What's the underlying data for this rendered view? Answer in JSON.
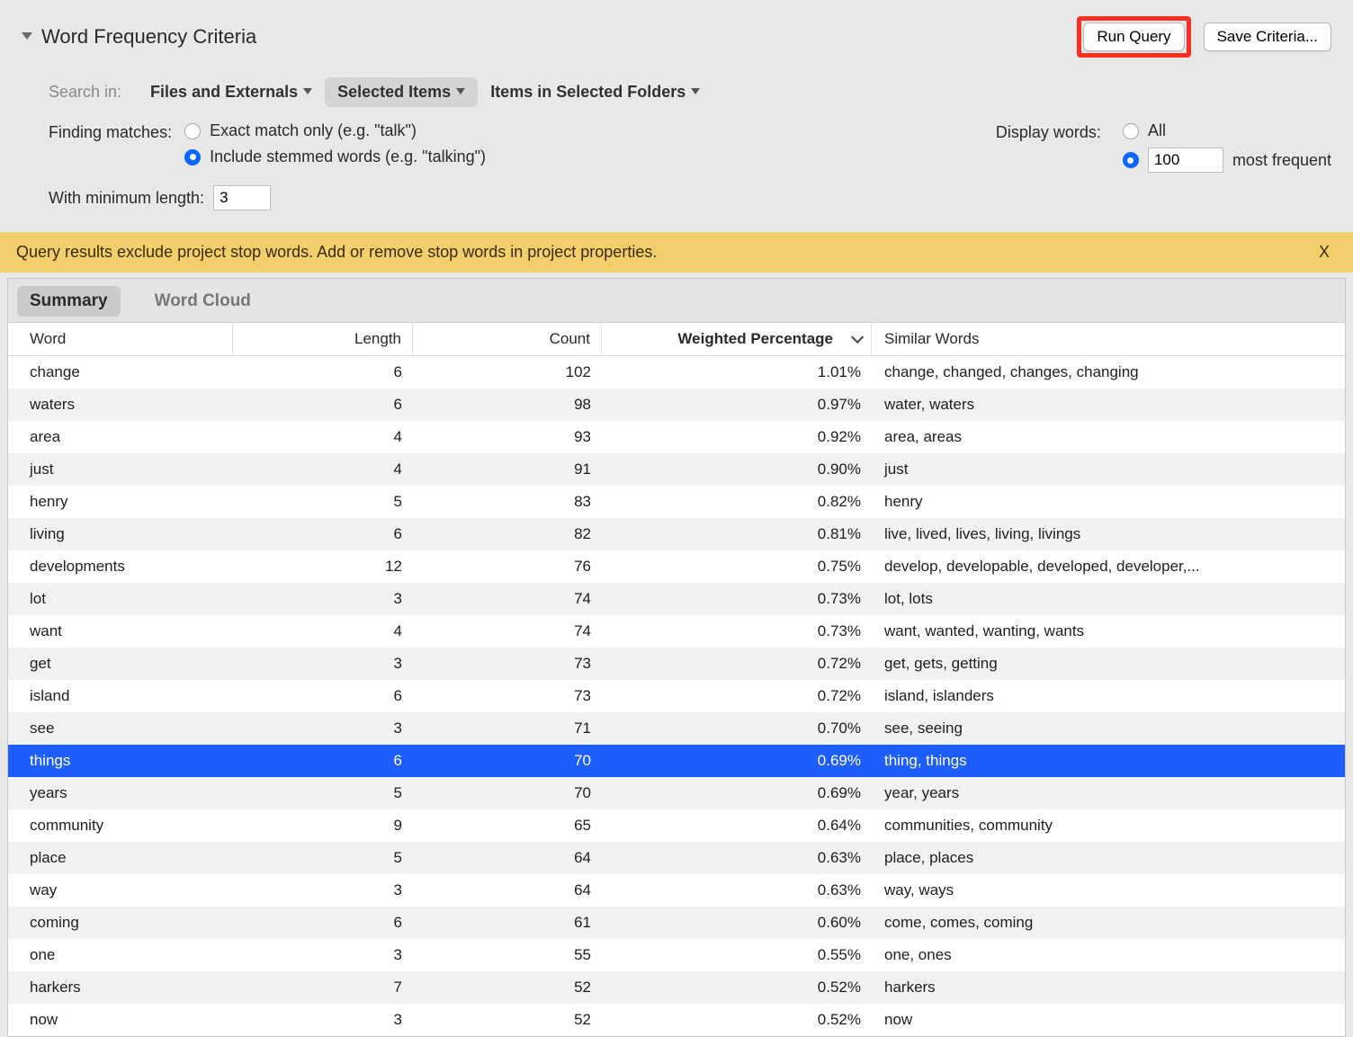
{
  "header": {
    "title": "Word Frequency Criteria",
    "run_query": "Run Query",
    "save_criteria": "Save Criteria..."
  },
  "search_in": {
    "label": "Search in:",
    "options": [
      "Files and Externals",
      "Selected Items",
      "Items in Selected Folders"
    ],
    "selected": "Selected Items"
  },
  "matches": {
    "label": "Finding matches:",
    "exact": "Exact match only (e.g. \"talk\")",
    "stemmed": "Include stemmed words (e.g. \"talking\")",
    "selected": "stemmed"
  },
  "display": {
    "label": "Display words:",
    "all": "All",
    "most_frequent_suffix": "most frequent",
    "count_value": "100",
    "selected": "count"
  },
  "min_length": {
    "label": "With minimum length:",
    "value": "3"
  },
  "notice": {
    "text": "Query results exclude project stop words. Add or remove stop words in project properties.",
    "close": "X"
  },
  "tabs": {
    "summary": "Summary",
    "wordcloud": "Word Cloud",
    "active": "summary"
  },
  "columns": {
    "word": "Word",
    "length": "Length",
    "count": "Count",
    "weighted": "Weighted Percentage",
    "similar": "Similar Words"
  },
  "selected_row": 12,
  "rows": [
    {
      "word": "change",
      "length": "6",
      "count": "102",
      "pct": "1.01%",
      "similar": "change, changed, changes, changing"
    },
    {
      "word": "waters",
      "length": "6",
      "count": "98",
      "pct": "0.97%",
      "similar": "water, waters"
    },
    {
      "word": "area",
      "length": "4",
      "count": "93",
      "pct": "0.92%",
      "similar": "area, areas"
    },
    {
      "word": "just",
      "length": "4",
      "count": "91",
      "pct": "0.90%",
      "similar": "just"
    },
    {
      "word": "henry",
      "length": "5",
      "count": "83",
      "pct": "0.82%",
      "similar": "henry"
    },
    {
      "word": "living",
      "length": "6",
      "count": "82",
      "pct": "0.81%",
      "similar": "live, lived, lives, living, livings"
    },
    {
      "word": "developments",
      "length": "12",
      "count": "76",
      "pct": "0.75%",
      "similar": "develop, developable, developed, developer,..."
    },
    {
      "word": "lot",
      "length": "3",
      "count": "74",
      "pct": "0.73%",
      "similar": "lot, lots"
    },
    {
      "word": "want",
      "length": "4",
      "count": "74",
      "pct": "0.73%",
      "similar": "want, wanted, wanting, wants"
    },
    {
      "word": "get",
      "length": "3",
      "count": "73",
      "pct": "0.72%",
      "similar": "get, gets, getting"
    },
    {
      "word": "island",
      "length": "6",
      "count": "73",
      "pct": "0.72%",
      "similar": "island, islanders"
    },
    {
      "word": "see",
      "length": "3",
      "count": "71",
      "pct": "0.70%",
      "similar": "see, seeing"
    },
    {
      "word": "things",
      "length": "6",
      "count": "70",
      "pct": "0.69%",
      "similar": "thing, things"
    },
    {
      "word": "years",
      "length": "5",
      "count": "70",
      "pct": "0.69%",
      "similar": "year, years"
    },
    {
      "word": "community",
      "length": "9",
      "count": "65",
      "pct": "0.64%",
      "similar": "communities, community"
    },
    {
      "word": "place",
      "length": "5",
      "count": "64",
      "pct": "0.63%",
      "similar": "place, places"
    },
    {
      "word": "way",
      "length": "3",
      "count": "64",
      "pct": "0.63%",
      "similar": "way, ways"
    },
    {
      "word": "coming",
      "length": "6",
      "count": "61",
      "pct": "0.60%",
      "similar": "come, comes, coming"
    },
    {
      "word": "one",
      "length": "3",
      "count": "55",
      "pct": "0.55%",
      "similar": "one, ones"
    },
    {
      "word": "harkers",
      "length": "7",
      "count": "52",
      "pct": "0.52%",
      "similar": "harkers"
    },
    {
      "word": "now",
      "length": "3",
      "count": "52",
      "pct": "0.52%",
      "similar": "now"
    }
  ]
}
